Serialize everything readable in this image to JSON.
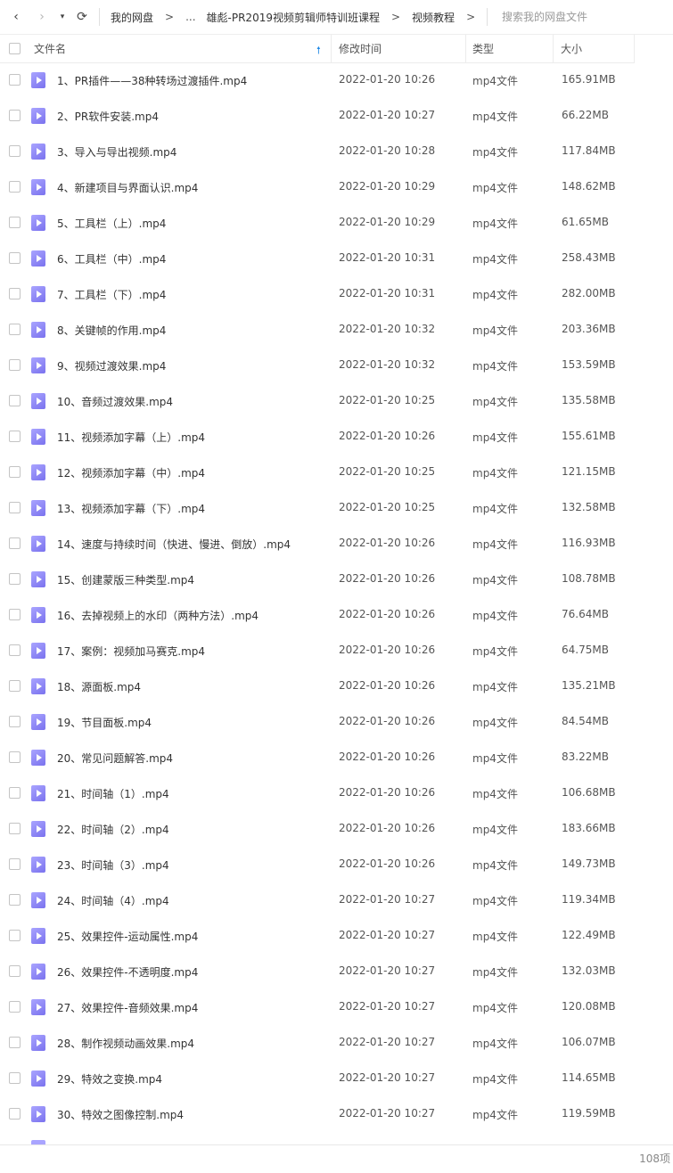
{
  "nav": {
    "back_icon": "‹",
    "forward_icon": "›",
    "dropdown_icon": "▾",
    "refresh_icon": "⟳"
  },
  "breadcrumb": {
    "items": [
      "我的网盘",
      "雄彪-PR2019视频剪辑师特训班课程",
      "视频教程"
    ],
    "ellipsis": "...",
    "separator": ">"
  },
  "search": {
    "placeholder": "搜索我的网盘文件"
  },
  "columns": {
    "name": "文件名",
    "modified": "修改时间",
    "type": "类型",
    "size": "大小",
    "sort_icon": "🠕"
  },
  "files": [
    {
      "name": "1、PR插件——38种转场过渡插件.mp4",
      "modified": "2022-01-20 10:26",
      "type": "mp4文件",
      "size": "165.91MB"
    },
    {
      "name": "2、PR软件安装.mp4",
      "modified": "2022-01-20 10:27",
      "type": "mp4文件",
      "size": "66.22MB"
    },
    {
      "name": "3、导入与导出视频.mp4",
      "modified": "2022-01-20 10:28",
      "type": "mp4文件",
      "size": "117.84MB"
    },
    {
      "name": "4、新建项目与界面认识.mp4",
      "modified": "2022-01-20 10:29",
      "type": "mp4文件",
      "size": "148.62MB"
    },
    {
      "name": "5、工具栏（上）.mp4",
      "modified": "2022-01-20 10:29",
      "type": "mp4文件",
      "size": "61.65MB"
    },
    {
      "name": "6、工具栏（中）.mp4",
      "modified": "2022-01-20 10:31",
      "type": "mp4文件",
      "size": "258.43MB"
    },
    {
      "name": "7、工具栏（下）.mp4",
      "modified": "2022-01-20 10:31",
      "type": "mp4文件",
      "size": "282.00MB"
    },
    {
      "name": "8、关键帧的作用.mp4",
      "modified": "2022-01-20 10:32",
      "type": "mp4文件",
      "size": "203.36MB"
    },
    {
      "name": "9、视频过渡效果.mp4",
      "modified": "2022-01-20 10:32",
      "type": "mp4文件",
      "size": "153.59MB"
    },
    {
      "name": "10、音频过渡效果.mp4",
      "modified": "2022-01-20 10:25",
      "type": "mp4文件",
      "size": "135.58MB"
    },
    {
      "name": "11、视频添加字幕（上）.mp4",
      "modified": "2022-01-20 10:26",
      "type": "mp4文件",
      "size": "155.61MB"
    },
    {
      "name": "12、视频添加字幕（中）.mp4",
      "modified": "2022-01-20 10:25",
      "type": "mp4文件",
      "size": "121.15MB"
    },
    {
      "name": "13、视频添加字幕（下）.mp4",
      "modified": "2022-01-20 10:25",
      "type": "mp4文件",
      "size": "132.58MB"
    },
    {
      "name": "14、速度与持续时间（快进、慢进、倒放）.mp4",
      "modified": "2022-01-20 10:26",
      "type": "mp4文件",
      "size": "116.93MB"
    },
    {
      "name": "15、创建蒙版三种类型.mp4",
      "modified": "2022-01-20 10:26",
      "type": "mp4文件",
      "size": "108.78MB"
    },
    {
      "name": "16、去掉视频上的水印（两种方法）.mp4",
      "modified": "2022-01-20 10:26",
      "type": "mp4文件",
      "size": "76.64MB"
    },
    {
      "name": "17、案例：视频加马赛克.mp4",
      "modified": "2022-01-20 10:26",
      "type": "mp4文件",
      "size": "64.75MB"
    },
    {
      "name": "18、源面板.mp4",
      "modified": "2022-01-20 10:26",
      "type": "mp4文件",
      "size": "135.21MB"
    },
    {
      "name": "19、节目面板.mp4",
      "modified": "2022-01-20 10:26",
      "type": "mp4文件",
      "size": "84.54MB"
    },
    {
      "name": "20、常见问题解答.mp4",
      "modified": "2022-01-20 10:26",
      "type": "mp4文件",
      "size": "83.22MB"
    },
    {
      "name": "21、时间轴（1）.mp4",
      "modified": "2022-01-20 10:26",
      "type": "mp4文件",
      "size": "106.68MB"
    },
    {
      "name": "22、时间轴（2）.mp4",
      "modified": "2022-01-20 10:26",
      "type": "mp4文件",
      "size": "183.66MB"
    },
    {
      "name": "23、时间轴（3）.mp4",
      "modified": "2022-01-20 10:26",
      "type": "mp4文件",
      "size": "149.73MB"
    },
    {
      "name": "24、时间轴（4）.mp4",
      "modified": "2022-01-20 10:27",
      "type": "mp4文件",
      "size": "119.34MB"
    },
    {
      "name": "25、效果控件-运动属性.mp4",
      "modified": "2022-01-20 10:27",
      "type": "mp4文件",
      "size": "122.49MB"
    },
    {
      "name": "26、效果控件-不透明度.mp4",
      "modified": "2022-01-20 10:27",
      "type": "mp4文件",
      "size": "132.03MB"
    },
    {
      "name": "27、效果控件-音频效果.mp4",
      "modified": "2022-01-20 10:27",
      "type": "mp4文件",
      "size": "120.08MB"
    },
    {
      "name": "28、制作视频动画效果.mp4",
      "modified": "2022-01-20 10:27",
      "type": "mp4文件",
      "size": "106.07MB"
    },
    {
      "name": "29、特效之变换.mp4",
      "modified": "2022-01-20 10:27",
      "type": "mp4文件",
      "size": "114.65MB"
    },
    {
      "name": "30、特效之图像控制.mp4",
      "modified": "2022-01-20 10:27",
      "type": "mp4文件",
      "size": "119.59MB"
    }
  ],
  "footer": {
    "count": "108项"
  },
  "colors": {
    "accent": "#1e88e5",
    "video_icon": "#8c85f5"
  }
}
